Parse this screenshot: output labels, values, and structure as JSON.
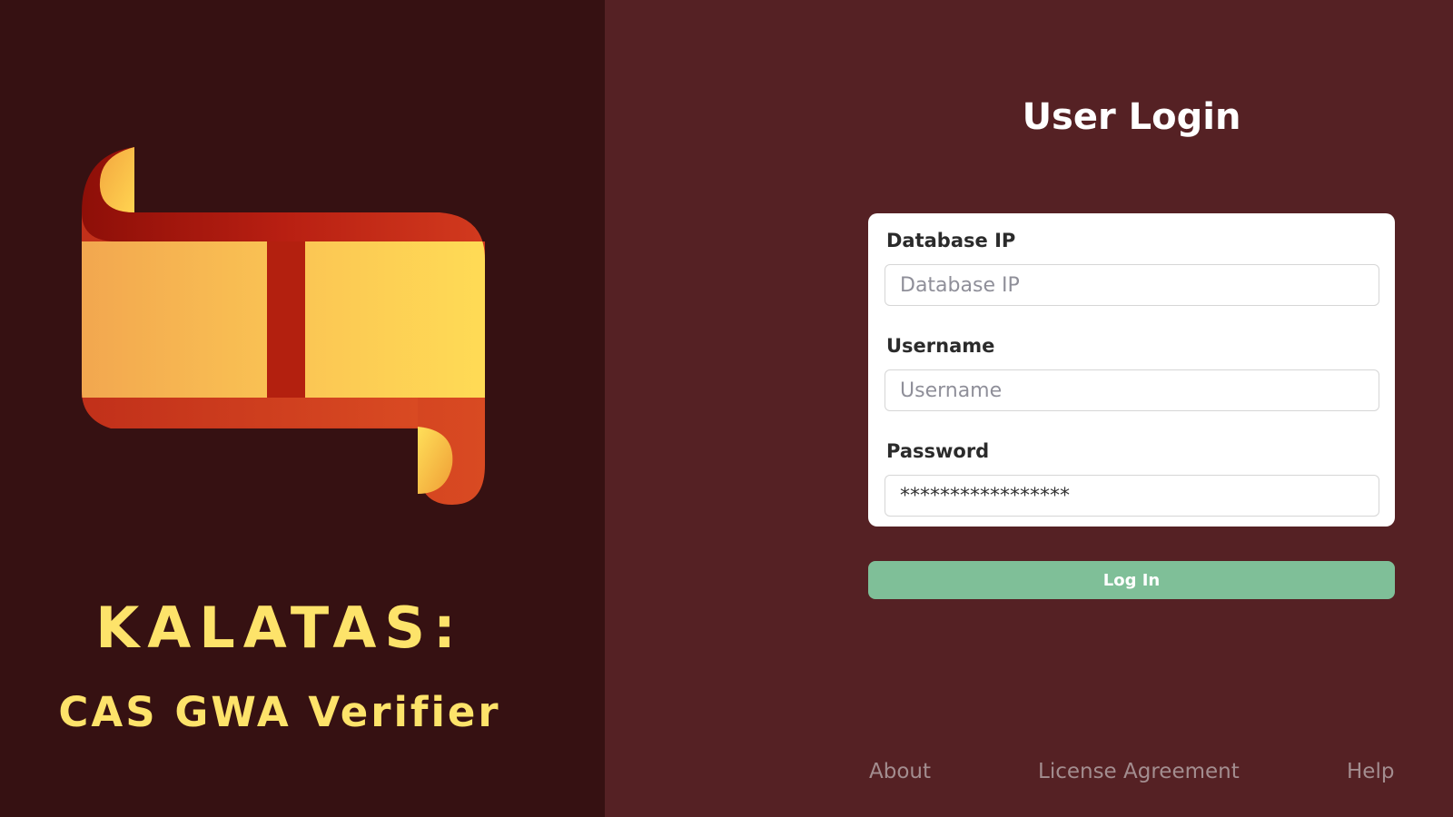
{
  "branding": {
    "title": "KALATAS:",
    "subtitle": "CAS GWA Verifier",
    "logo_icon": "scroll-icon",
    "title_color": "#fde36a"
  },
  "login": {
    "heading": "User Login",
    "fields": [
      {
        "label": "Database IP",
        "placeholder": "Database IP",
        "value": ""
      },
      {
        "label": "Username",
        "placeholder": "Username",
        "value": ""
      },
      {
        "label": "Password",
        "placeholder": "",
        "value": "*****************"
      }
    ],
    "submit_label": "Log In"
  },
  "footer": {
    "about": "About",
    "license": "License Agreement",
    "help": "Help"
  },
  "colors": {
    "left_background": "#361112",
    "right_background": "#552124",
    "button": "#7fbf98",
    "card": "#ffffff"
  }
}
